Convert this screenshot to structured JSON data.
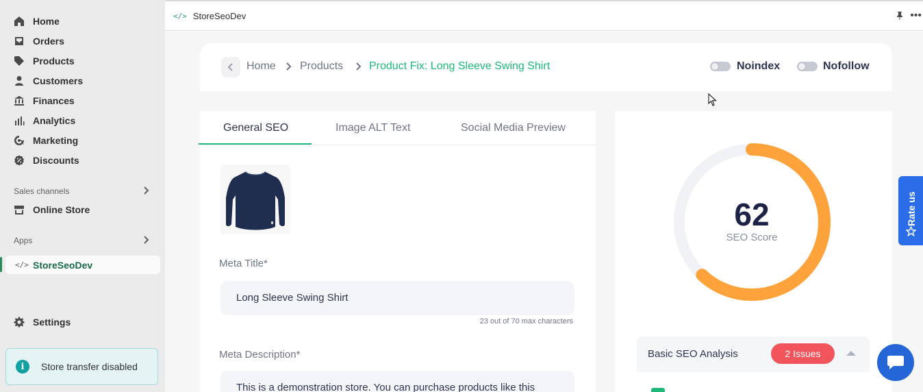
{
  "sidebar": {
    "items": [
      {
        "label": "Home",
        "icon": "home-icon"
      },
      {
        "label": "Orders",
        "icon": "orders-icon"
      },
      {
        "label": "Products",
        "icon": "tag-icon"
      },
      {
        "label": "Customers",
        "icon": "person-icon"
      },
      {
        "label": "Finances",
        "icon": "bank-icon"
      },
      {
        "label": "Analytics",
        "icon": "bar-chart-icon"
      },
      {
        "label": "Marketing",
        "icon": "target-icon"
      },
      {
        "label": "Discounts",
        "icon": "discount-icon"
      }
    ],
    "sales_channels_label": "Sales channels",
    "online_store_label": "Online Store",
    "apps_label": "Apps",
    "active_app_label": "StoreSeoDev",
    "settings_label": "Settings",
    "notice_text": "Store transfer disabled"
  },
  "topbar": {
    "app_title": "StoreSeoDev"
  },
  "header": {
    "breadcrumb": [
      "Home",
      "Products",
      "Product Fix: Long Sleeve Swing Shirt"
    ],
    "noindex_label": "Noindex",
    "nofollow_label": "Nofollow",
    "noindex_on": false,
    "nofollow_on": false
  },
  "tabs": [
    "General SEO",
    "Image ALT Text",
    "Social Media Preview"
  ],
  "active_tab": "General SEO",
  "form": {
    "meta_title_label": "Meta Title*",
    "meta_title_value": "Long Sleeve Swing Shirt",
    "meta_title_count": "23 out of 70 max characters",
    "meta_description_label": "Meta Description*",
    "meta_description_value": "This is a demonstration store. You can purchase products like this"
  },
  "score": {
    "value": "62",
    "label": "SEO Score",
    "percent": 62,
    "color": "#fea33c",
    "track_color": "#f1f2f5"
  },
  "analysis": {
    "title": "Basic SEO Analysis",
    "badge": "2 Issues"
  },
  "widgets": {
    "rate_us": "Rate us"
  },
  "colors": {
    "accent_green": "#1eb97a",
    "badge_red": "#f2545b",
    "brand_blue": "#2b6de8"
  }
}
